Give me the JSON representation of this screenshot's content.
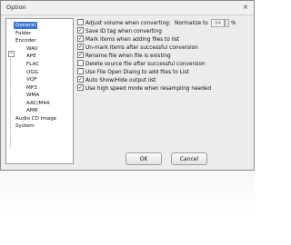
{
  "window": {
    "title": "Option",
    "close_glyph": "×"
  },
  "tree": {
    "items": [
      {
        "label": "General",
        "selected": true
      },
      {
        "label": "Folder"
      },
      {
        "label": "Encoder"
      },
      {
        "label": "WAV"
      },
      {
        "label": "APE"
      },
      {
        "label": "FLAC"
      },
      {
        "label": "OGG"
      },
      {
        "label": "VQF"
      },
      {
        "label": "MP3"
      },
      {
        "label": "WMA"
      },
      {
        "label": "AAC/M4A"
      },
      {
        "label": "AMR"
      },
      {
        "label": "Audio CD Image"
      },
      {
        "label": "System"
      }
    ],
    "expander_glyph": "−"
  },
  "options": [
    {
      "label": "Adjust volume when converting:",
      "checked": false
    },
    {
      "label": "Save ID tag when converting",
      "checked": true
    },
    {
      "label": "Mark items when adding files to list",
      "checked": true
    },
    {
      "label": "Un-mark items after successful conversion",
      "checked": true
    },
    {
      "label": "Rename file when file is existing",
      "checked": true
    },
    {
      "label": "Delete source file after successful conversion",
      "checked": false
    },
    {
      "label": "Use File Open Dialog to add files to List",
      "checked": false
    },
    {
      "label": "Auto Show/Hide output list",
      "checked": true
    },
    {
      "label": "Use high speed mode when resampling needed",
      "checked": true
    }
  ],
  "normalize": {
    "label": "Normalize to",
    "value": "94",
    "unit": "%"
  },
  "buttons": {
    "ok": "OK",
    "cancel": "Cancel"
  },
  "check_glyph": "✓"
}
